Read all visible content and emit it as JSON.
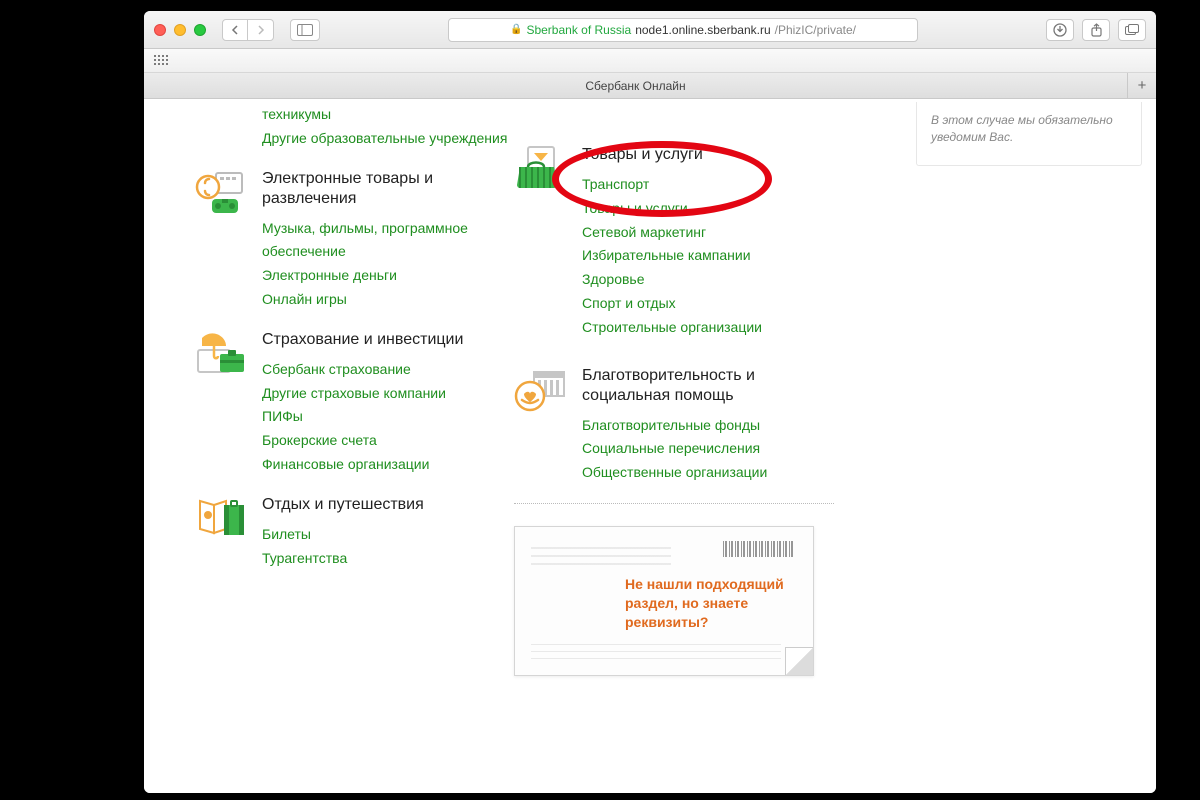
{
  "browser": {
    "secure_label": "Sberbank of Russia",
    "host": "node1.online.sberbank.ru",
    "path": "/PhizIC/private/",
    "tab_title": "Сбербанк Онлайн"
  },
  "sidebar_note": "В этом случае мы обязательно уведомим Вас.",
  "left_orphan_links": [
    "техникумы",
    "Другие образовательные учреждения"
  ],
  "categories_left": [
    {
      "title": "Электронные товары и развлечения",
      "links": [
        "Музыка, фильмы, программное обеспечение",
        "Электронные деньги",
        "Онлайн игры"
      ]
    },
    {
      "title": "Страхование и инвестиции",
      "links": [
        "Сбербанк страхование",
        "Другие страховые компании",
        "ПИФы",
        "Брокерские счета",
        "Финансовые организации"
      ]
    },
    {
      "title": "Отдых и путешествия",
      "links": [
        "Билеты",
        "Турагентства"
      ]
    }
  ],
  "categories_right": [
    {
      "title": "Товары и услуги",
      "links": [
        "Транспорт",
        "Товары и услуги",
        "Сетевой маркетинг",
        "Избирательные кампании",
        "Здоровье",
        "Спорт и отдых",
        "Строительные организации"
      ]
    },
    {
      "title": "Благотворительность и социальная помощь",
      "links": [
        "Благотворительные фонды",
        "Социальные перечисления",
        "Общественные организации"
      ]
    }
  ],
  "promo_message": "Не нашли подходящий раздел, но знаете реквизиты?"
}
